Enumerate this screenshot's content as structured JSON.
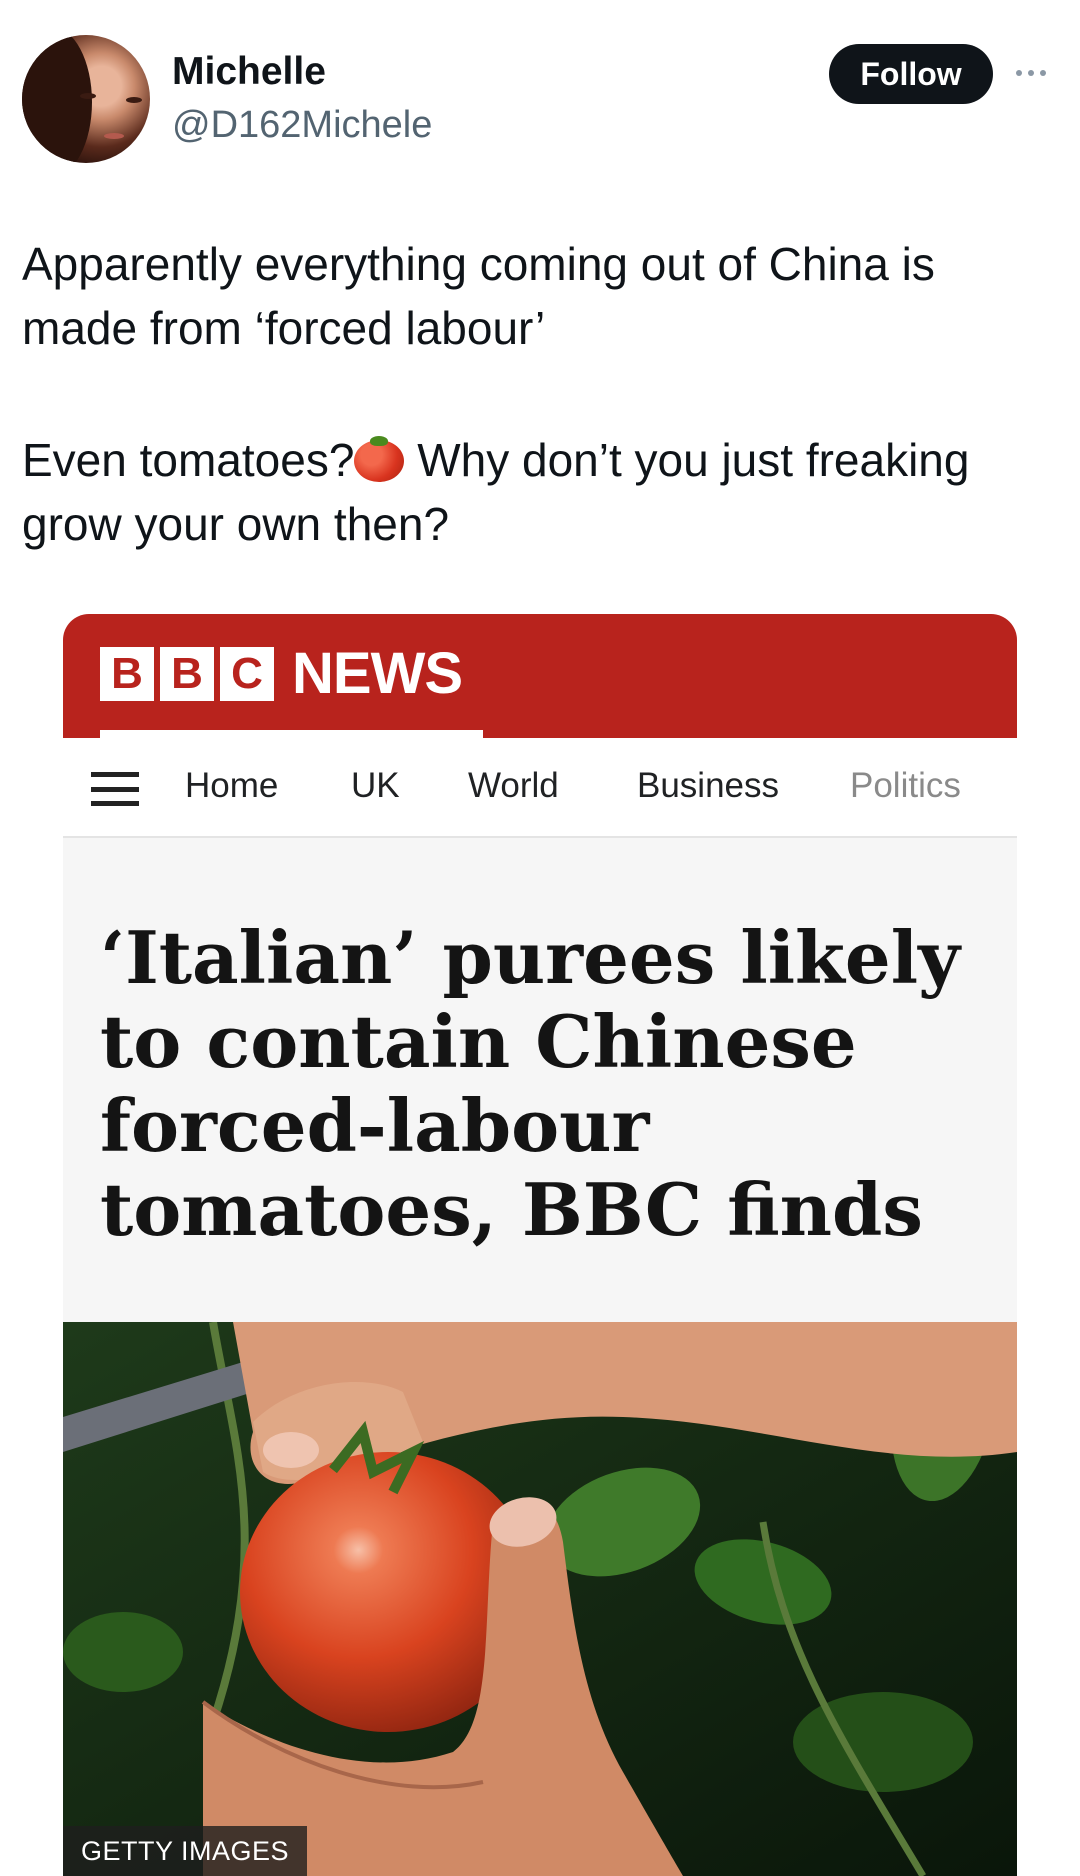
{
  "author": {
    "name": "Michelle",
    "handle": "@D162Michele"
  },
  "actions": {
    "follow_label": "Follow",
    "more_icon": "more-horizontal-icon"
  },
  "tweet": {
    "paragraph1": "Apparently everything coming out of China is made from ‘forced labour’",
    "paragraph2_start": "Even tomatoes?",
    "paragraph2_end": " Why don’t you just freaking grow your own then?",
    "emoji": "tomato"
  },
  "card": {
    "brand": {
      "letters": [
        "B",
        "B",
        "C"
      ],
      "wordmark": "NEWS",
      "color": "#b8231d"
    },
    "nav": {
      "items": [
        "Home",
        "UK",
        "World",
        "Business",
        "Politics"
      ],
      "menu_icon": "hamburger-menu-icon"
    },
    "headline": "‘Italian’ purees likely to contain Chinese forced-labour tomatoes, BBC finds",
    "image": {
      "subject": "hands picking a tomato",
      "credit": "GETTY IMAGES"
    }
  }
}
